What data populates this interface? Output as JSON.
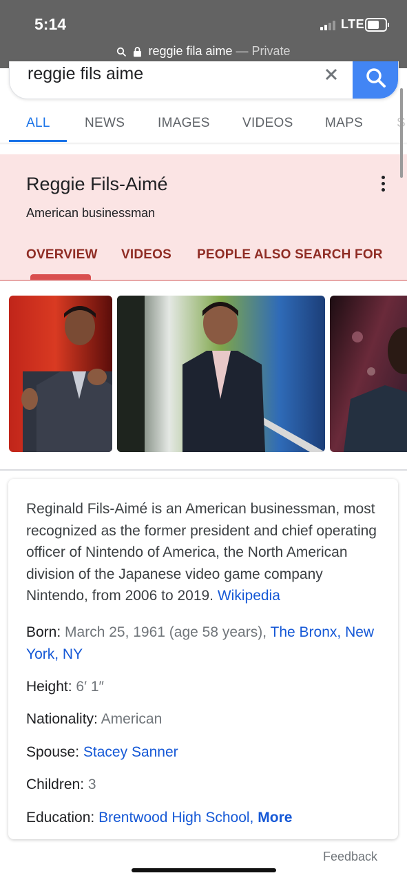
{
  "status": {
    "time": "5:14",
    "network": "LTE",
    "url": "reggie fila aime",
    "private_label": "— Private"
  },
  "search": {
    "query": "reggie fils aime",
    "clear_icon": "close-icon",
    "search_icon": "search-icon",
    "accent": "#4285f4"
  },
  "tabs": [
    {
      "label": "ALL",
      "active": true
    },
    {
      "label": "NEWS"
    },
    {
      "label": "IMAGES"
    },
    {
      "label": "VIDEOS"
    },
    {
      "label": "MAPS"
    },
    {
      "label": "S"
    }
  ],
  "panel": {
    "title": "Reggie Fils-Aimé",
    "subtitle": "American businessman",
    "tabs": [
      "OVERVIEW",
      "VIDEOS",
      "PEOPLE ALSO SEARCH FOR"
    ],
    "header_bg": "#fbe4e4",
    "tab_color": "#8f2c24"
  },
  "description": {
    "text": "Reginald Fils-Aimé is an American businessman, most recognized as the former president and chief operating officer of Nintendo of America, the North American division of the Japanese video game company Nintendo, from 2006 to 2019.",
    "source": "Wikipedia"
  },
  "facts": {
    "born": {
      "label": "Born:",
      "value": "March 25, 1961 (age 58 years),",
      "place": "The Bronx, New York, NY"
    },
    "height": {
      "label": "Height:",
      "value": "6′ 1″"
    },
    "nationality": {
      "label": "Nationality:",
      "value": "American"
    },
    "spouse": {
      "label": "Spouse:",
      "value": "Stacey Sanner"
    },
    "children": {
      "label": "Children:",
      "value": "3"
    },
    "education": {
      "label": "Education:",
      "value": "Brentwood High School,",
      "more": "More"
    }
  },
  "footer": {
    "feedback": "Feedback"
  }
}
